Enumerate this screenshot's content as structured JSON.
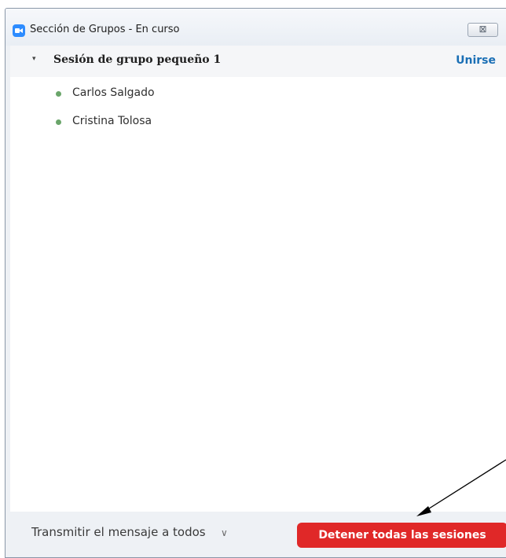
{
  "window": {
    "title": "Sección de Grupos - En curso",
    "close_glyph": "⊠"
  },
  "group": {
    "caret": "▾",
    "name": "Sesión de grupo pequeño 1",
    "join_label": "Unirse",
    "participants": [
      {
        "name": "Carlos Salgado",
        "status_color": "#6aa56a"
      },
      {
        "name": "Cristina Tolosa",
        "status_color": "#6aa56a"
      }
    ]
  },
  "footer": {
    "broadcast_label": "Transmitir el mensaje a todos",
    "broadcast_chevron": "∨",
    "stop_label": "Detener todas las sesiones"
  },
  "colors": {
    "accent_blue": "#2d8cff",
    "join_link": "#1a6fb5",
    "stop_button": "#e02828"
  },
  "icons": {
    "app": "zoom-camera-icon",
    "close": "close-icon",
    "caret": "caret-down-icon",
    "status": "online-dot-icon",
    "annotation": "arrow-annotation"
  }
}
